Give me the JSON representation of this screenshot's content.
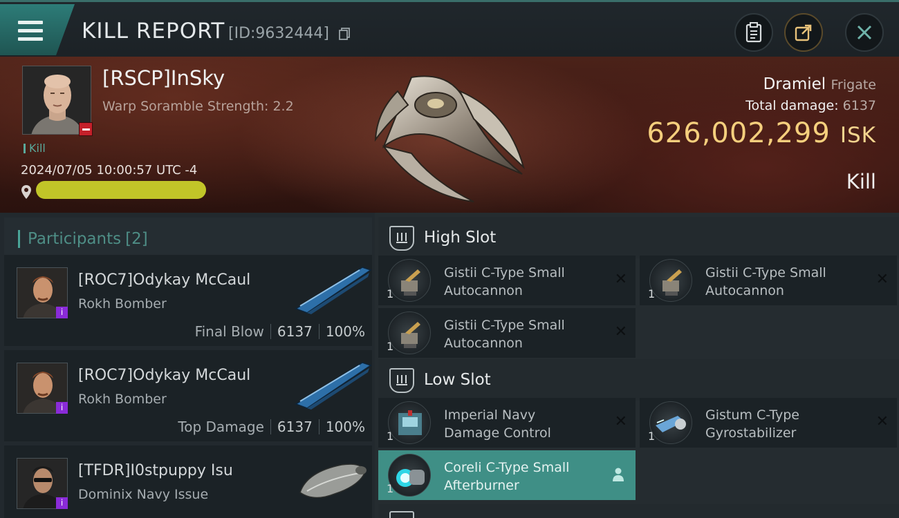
{
  "header": {
    "title": "KILL REPORT",
    "report_id": "[ID:9632444]"
  },
  "victim": {
    "name": "[RSCP]InSky",
    "warp_scramble": "Warp Soramble Strength: 2.2",
    "tag": "Kill",
    "datetime": "2024/07/05 10:00:57 UTC -4",
    "ship_name": "Dramiel",
    "ship_class": "Frigate",
    "total_damage_label": "Total damage:",
    "total_damage": "6137",
    "isk_value": "626,002,299",
    "isk_unit": "ISK",
    "result": "Kill"
  },
  "participants": {
    "label": "Participants",
    "count": "[2]",
    "rows": [
      {
        "name": "[ROC7]Odykay McCaul",
        "ship": "Rokh Bomber",
        "role": "Final Blow",
        "damage": "6137",
        "percent": "100%"
      },
      {
        "name": "[ROC7]Odykay McCaul",
        "ship": "Rokh Bomber",
        "role": "Top Damage",
        "damage": "6137",
        "percent": "100%"
      },
      {
        "name": "[TFDR]I0stpuppy Isu",
        "ship": "Dominix Navy Issue"
      }
    ]
  },
  "fitting": {
    "high_slot_label": "High Slot",
    "low_slot_label": "Low Slot",
    "high_slot": [
      {
        "line1": "Gistii C-Type Small",
        "line2": "Autocannon",
        "qty": "1"
      },
      {
        "line1": "Gistii C-Type Small",
        "line2": "Autocannon",
        "qty": "1"
      },
      {
        "line1": "Gistii C-Type Small",
        "line2": "Autocannon",
        "qty": "1"
      }
    ],
    "low_slot": [
      {
        "line1": "Imperial Navy",
        "line2": "Damage Control",
        "qty": "1"
      },
      {
        "line1": "Gistum C-Type",
        "line2": "Gyrostabilizer",
        "qty": "1"
      },
      {
        "line1": "Coreli C-Type Small",
        "line2": "Afterburner",
        "qty": "1"
      }
    ]
  },
  "colors": {
    "accent_teal": "#3f8f86",
    "isk_gold": "#f5cf7d",
    "badge_red": "#c4202a",
    "role_purple": "#8a2bd8"
  }
}
